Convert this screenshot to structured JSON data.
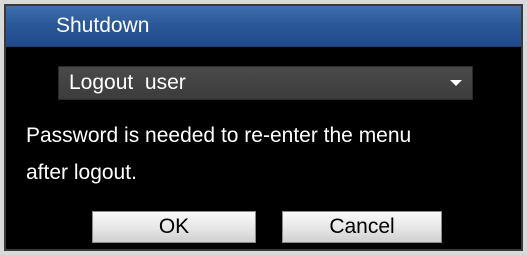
{
  "dialog": {
    "title": "Shutdown",
    "select": {
      "value": "Logout  user"
    },
    "message_line1": "Password is needed to re-enter the menu",
    "message_line2": "after logout.",
    "ok_label": "OK",
    "cancel_label": "Cancel"
  },
  "colors": {
    "titlebar": "#2b5898",
    "background": "#000000",
    "text": "#ffffff"
  },
  "icons": {
    "dropdown": "chevron-down-icon"
  }
}
